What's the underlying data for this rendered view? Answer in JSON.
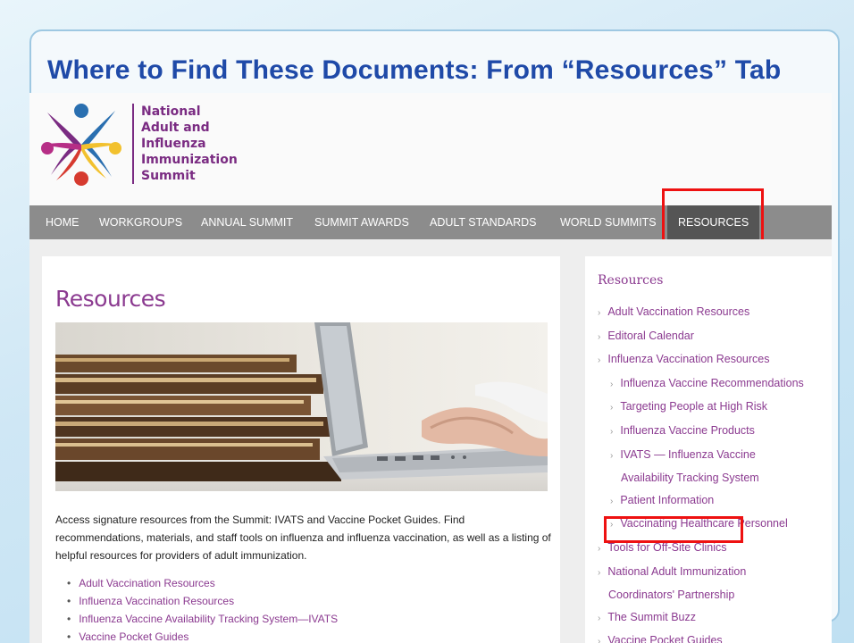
{
  "slide": {
    "title": "Where to Find These Documents:  From “Resources” Tab"
  },
  "logo": {
    "lines": [
      "National",
      "Adult and",
      "Influenza",
      "Immunization",
      "Summit"
    ],
    "colors": {
      "purple": "#7a2b82",
      "blue": "#2a6fb0",
      "red": "#d63a2f",
      "yellow": "#f2c12e",
      "magenta": "#b62e86"
    }
  },
  "nav": {
    "items": [
      {
        "label": "HOME"
      },
      {
        "label": "WORKGROUPS"
      },
      {
        "label": "ANNUAL SUMMIT"
      },
      {
        "label": "SUMMIT AWARDS"
      },
      {
        "label": "ADULT STANDARDS"
      },
      {
        "label": "WORLD SUMMITS"
      },
      {
        "label": "RESOURCES",
        "active": true
      }
    ]
  },
  "main": {
    "title": "Resources",
    "intro": "Access signature resources from the Summit: IVATS and Vaccine Pocket Guides. Find recommendations, materials, and staff tools on influenza and influenza vaccination, as well as a listing of helpful resources for providers of adult immunization.",
    "links": [
      "Adult Vaccination Resources",
      "Influenza Vaccination Resources",
      "Influenza Vaccine Availability Tracking System—IVATS",
      "Vaccine Pocket Guides"
    ]
  },
  "sidebar": {
    "title": "Resources",
    "items": [
      {
        "label": "Adult Vaccination Resources"
      },
      {
        "label": "Editoral Calendar"
      },
      {
        "label": "Influenza Vaccination Resources"
      },
      {
        "label": "Influenza Vaccine Recommendations"
      },
      {
        "label": "Targeting People at High Risk"
      },
      {
        "label": "Influenza Vaccine Products"
      },
      {
        "label": "IVATS — Influenza Vaccine"
      },
      {
        "label": "Availability Tracking System"
      },
      {
        "label": "Patient Information"
      },
      {
        "label": "Vaccinating Healthcare Personnel"
      },
      {
        "label": "Tools for Off-Site Clinics"
      },
      {
        "label": "National Adult Immunization"
      },
      {
        "label": "Coordinators' Partnership"
      },
      {
        "label": "The Summit Buzz"
      },
      {
        "label": "Vaccine Pocket Guides"
      }
    ]
  },
  "colors": {
    "title_blue": "#1f4aa8",
    "link_purple": "#8b3a90",
    "highlight_red": "#ee1111",
    "nav_gray": "#8c8c8c"
  }
}
